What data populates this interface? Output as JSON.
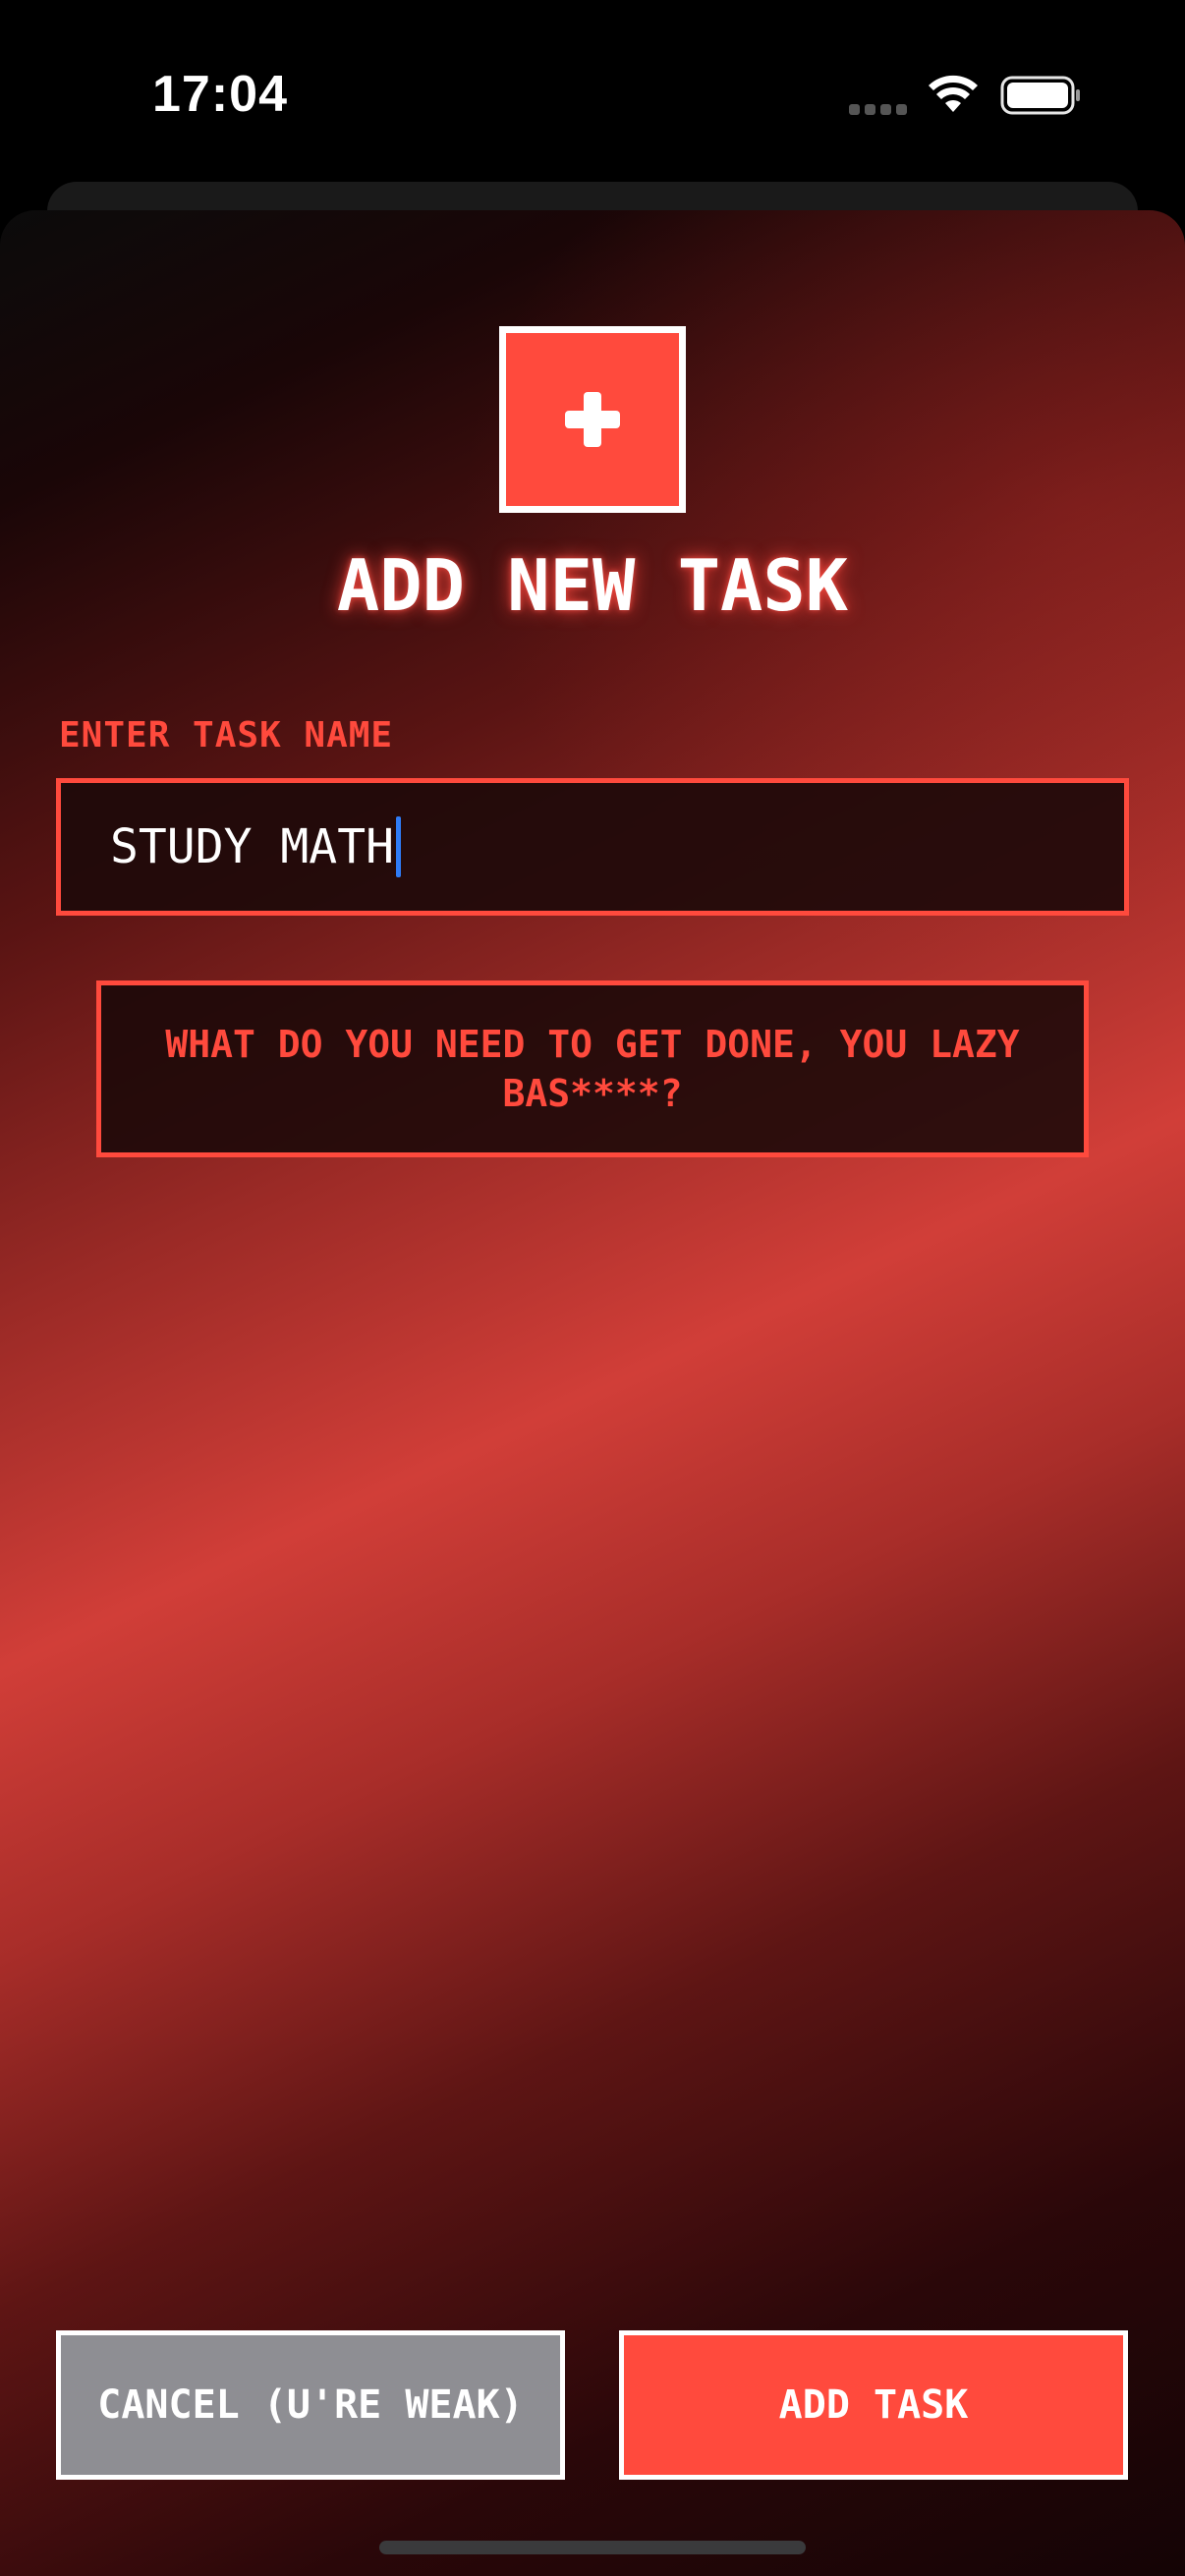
{
  "status_bar": {
    "time": "17:04"
  },
  "modal": {
    "title": "ADD NEW TASK",
    "icon": "plus-icon",
    "field_label": "ENTER TASK NAME",
    "task_input": {
      "value": "STUDY MATH",
      "placeholder": ""
    },
    "taunt": "WHAT DO YOU NEED TO GET DONE, YOU LAZY BAS****?",
    "cancel_label": "CANCEL (U'RE WEAK)",
    "add_label": "ADD TASK"
  },
  "colors": {
    "accent": "#ff4a3d",
    "cancel_gray": "#8e8e93",
    "cursor_blue": "#2f7cf6"
  }
}
